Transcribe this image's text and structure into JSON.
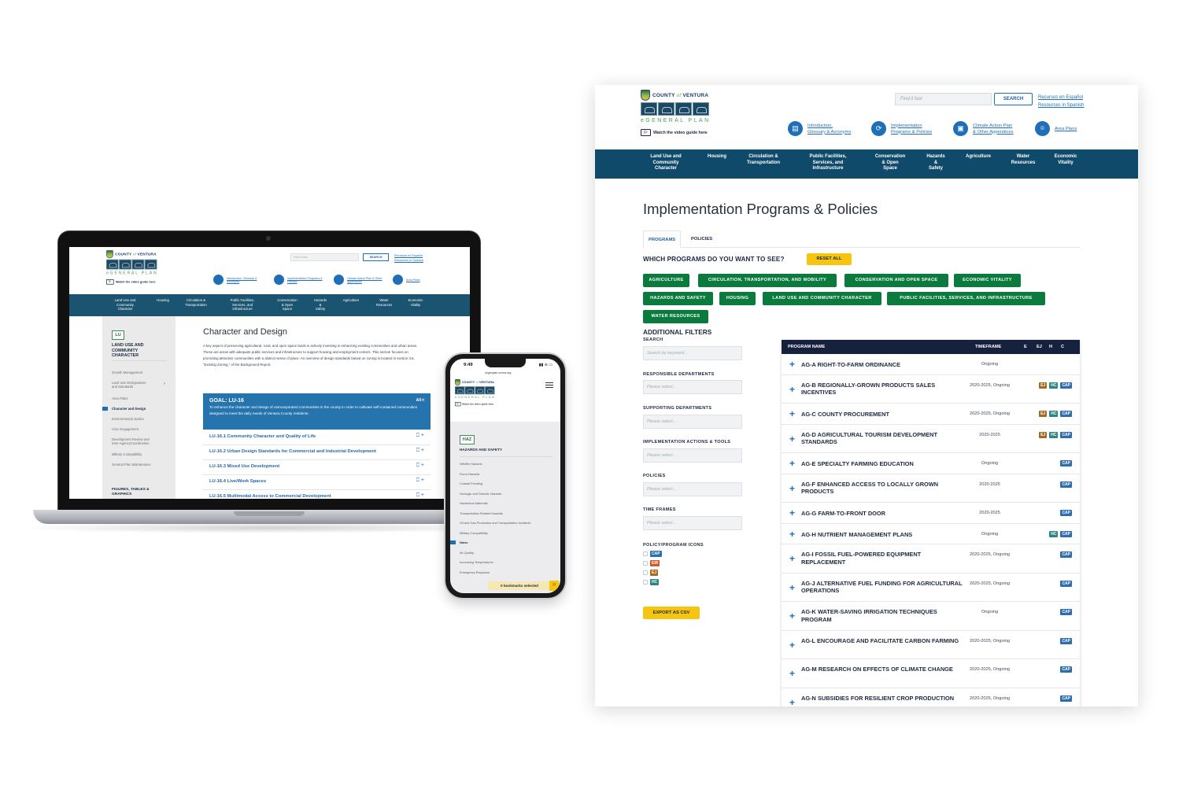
{
  "main_page": {
    "logo": {
      "county": "COUNTY",
      "of": "of",
      "ventura": "VENTURA",
      "plan": "eGENERAL PLAN",
      "video_guide": "Watch the video guide here"
    },
    "search": {
      "placeholder": "Find it fast",
      "button": "SEARCH"
    },
    "language_links": [
      "Recursos en Español",
      "Resources in Spanish"
    ],
    "quick_links": [
      {
        "icon": "book-icon",
        "label_1": "Introduction,",
        "label_2": "Glossary & Acronyms"
      },
      {
        "icon": "programs-icon",
        "label_1": "Implementation",
        "label_2": "Programs & Policies"
      },
      {
        "icon": "climate-icon",
        "label_1": "Climate Action Plan",
        "label_2": "& Other Appendices"
      },
      {
        "icon": "map-pin-icon",
        "label_1": "Area Plans",
        "label_2": ""
      }
    ],
    "nav": [
      "Land Use and\nCommunity\nCharacter",
      "Housing",
      "Circulation &\nTransportation",
      "Public Facilities,\nServices, and\nInfrastructure",
      "Conservation\n& Open\nSpace",
      "Hazards\n&\nSafety",
      "Agriculture",
      "Water\nResources",
      "Economic\nVitality"
    ],
    "title": "Implementation Programs & Policies",
    "tabs": [
      {
        "label": "PROGRAMS",
        "active": true
      },
      {
        "label": "POLICIES",
        "active": false
      }
    ],
    "which_label": "WHICH PROGRAMS DO YOU WANT TO SEE?",
    "reset_label": "RESET ALL",
    "categories": [
      "AGRICULTURE",
      "CIRCULATION, TRANSPORTATION, AND MOBILITY",
      "CONSERVATION AND OPEN SPACE",
      "ECONOMIC VITALITY",
      "HAZARDS AND SAFETY",
      "HOUSING",
      "LAND USE AND COMMUNITY CHARACTER",
      "PUBLIC FACILITIES, SERVICES, AND INFRASTRUCTURE",
      "WATER RESOURCES"
    ],
    "filters": {
      "title": "ADDITIONAL FILTERS",
      "search_label": "SEARCH",
      "search_placeholder": "Search by keyword...",
      "selects": [
        {
          "label": "RESPONSIBLE DEPARTMENTS",
          "placeholder": "Please select..."
        },
        {
          "label": "SUPPORTING DEPARTMENTS",
          "placeholder": "Please select..."
        },
        {
          "label": "IMPLEMENTATION ACTIONS & TOOLS",
          "placeholder": "Please select..."
        },
        {
          "label": "POLICIES",
          "placeholder": "Please select..."
        },
        {
          "label": "TIME FRAMES",
          "placeholder": "Please select..."
        }
      ],
      "icons_label": "POLICY/PROGRAM ICONS",
      "icon_options": [
        "CAP",
        "EIR",
        "EJ",
        "HC"
      ],
      "export_label": "EXPORT AS CSV"
    },
    "table": {
      "headers": {
        "name": "PROGRAM NAME",
        "timeframe": "TIMEFRAME",
        "e": "E",
        "ej": "EJ",
        "h": "H",
        "c": "C"
      },
      "rows": [
        {
          "name": "AG-A RIGHT-TO-FARM ORDINANCE",
          "timeframe": "Ongoing",
          "badges": []
        },
        {
          "name": "AG-B REGIONALLY-GROWN PRODUCTS SALES INCENTIVES",
          "timeframe": "2020-2025, Ongoing",
          "badges": [
            "EJ",
            "HC",
            "CAP"
          ]
        },
        {
          "name": "AG-C COUNTY PROCUREMENT",
          "timeframe": "2020-2025, Ongoing",
          "badges": [
            "EJ",
            "HC",
            "CAP"
          ]
        },
        {
          "name": "AG-D AGRICULTURAL TOURISM DEVELOPMENT STANDARDS",
          "timeframe": "2020-2025",
          "badges": [
            "EJ",
            "HC",
            "CAP"
          ]
        },
        {
          "name": "AG-E SPECIALTY FARMING EDUCATION",
          "timeframe": "Ongoing",
          "badges": [
            "CAP"
          ]
        },
        {
          "name": "AG-F ENHANCED ACCESS TO LOCALLY GROWN PRODUCTS",
          "timeframe": "2020-2025",
          "badges": [
            "CAP"
          ]
        },
        {
          "name": "AG-G FARM-TO-FRONT DOOR",
          "timeframe": "2020-2025",
          "badges": [
            "CAP"
          ]
        },
        {
          "name": "AG-H NUTRIENT MANAGEMENT PLANS",
          "timeframe": "Ongoing",
          "badges": [
            "HC",
            "CAP"
          ]
        },
        {
          "name": "AG-I FOSSIL FUEL-POWERED EQUIPMENT REPLACEMENT",
          "timeframe": "2020-2025, Ongoing",
          "badges": [
            "CAP"
          ]
        },
        {
          "name": "AG-J ALTERNATIVE FUEL FUNDING FOR AGRICULTURAL OPERATIONS",
          "timeframe": "2020-2025, Ongoing",
          "badges": [
            "CAP"
          ]
        },
        {
          "name": "AG-K WATER-SAVING IRRIGATION TECHNIQUES PROGRAM",
          "timeframe": "Ongoing",
          "badges": [
            "CAP"
          ]
        },
        {
          "name": "AG-L ENCOURAGE AND FACILITATE CARBON FARMING",
          "timeframe": "2020-2025, Ongoing",
          "badges": [
            "CAP"
          ]
        },
        {
          "name": "AG-M RESEARCH ON EFFECTS OF CLIMATE CHANGE",
          "timeframe": "2020-2025, Ongoing",
          "badges": [
            "CAP"
          ]
        },
        {
          "name": "AG-N SUBSIDIES FOR RESILIENT CROP PRODUCTION",
          "timeframe": "2020-2025, Ongoing",
          "badges": [
            "CAP"
          ]
        }
      ]
    }
  },
  "laptop_page": {
    "search_placeholder": "Find it fast",
    "search_button": "SEARCH",
    "language_links": [
      "Recursos en Español",
      "Resources in Spanish"
    ],
    "quick_links": [
      "Introduction, Glossary & Acronyms",
      "Implementation Programs & Policies",
      "Climate Action Plan & Other Appendices",
      "Area Plans"
    ],
    "sidebar": {
      "badge": "LU",
      "title": "LAND USE AND\nCOMMUNITY\nCHARACTER",
      "items": [
        {
          "label": "Growth Management",
          "active": false
        },
        {
          "label": "Land Use Designations\nand Standards",
          "active": false,
          "has_arrow": true
        },
        {
          "label": "Area Plans",
          "active": false
        },
        {
          "label": "Character and Design",
          "active": true
        },
        {
          "label": "Environmental Justice",
          "active": false
        },
        {
          "label": "Civic Engagement",
          "active": false
        },
        {
          "label": "Development Review and\nInter-AgencyCoordination",
          "active": false
        },
        {
          "label": "Military Compatibility",
          "active": false
        },
        {
          "label": "General Plan Maintenance",
          "active": false
        }
      ],
      "figures_label": "FIGURES, TABLES &\nGRAPHICS"
    },
    "title": "Character and Design",
    "paragraph": "A key aspect of preserving agricultural, rural, and open space lands is actively investing in enhancing existing communities and urban areas. These are areas with adequate public services and infrastructure to support housing and employment centers. This section focuses on promoting attractive communities with a distinct sense of place. An overview of design standards based on zoning is located in section 3.6, “Existing Zoning,” of the Background Report.",
    "goal": {
      "title": "GOAL: LU-16",
      "all_label": "All",
      "description": "To enhance the character and design of unincorporated communities in the county in order to cultivate self-contained communities designed to meet the daily needs of Ventura County residents."
    },
    "policies": [
      "LU-16.1 Community Character and Quality of Life",
      "LU-16.2 Urban Design Standards for Commercial and Industrial Development",
      "LU-16.3 Mixed Use Development",
      "LU-16.4 Live/Work Spaces",
      "LU-16.5 Multimodal Access to Commercial Development"
    ]
  },
  "phone_page": {
    "time": "9:49",
    "url": "vcgenplan.vcrma.org",
    "section_badge": "HAZ",
    "section_title": "HAZARDS AND SAFETY",
    "items": [
      {
        "label": "Wildfire Hazards",
        "active": false
      },
      {
        "label": "Flood Hazards",
        "active": false
      },
      {
        "label": "Coastal Flooding",
        "active": false
      },
      {
        "label": "Geologic and Seismic Hazards",
        "active": false
      },
      {
        "label": "Hazardous Materials",
        "active": false
      },
      {
        "label": "Transportation Related Hazards",
        "active": false
      },
      {
        "label": "Oil and Gas Production and Transportation Incidents",
        "active": false
      },
      {
        "label": "Military Compatibility",
        "active": false
      },
      {
        "label": "Noise",
        "active": true
      },
      {
        "label": "Air Quality",
        "active": false
      },
      {
        "label": "Increasing Temperatures",
        "active": false
      },
      {
        "label": "Emergency Response",
        "active": false
      }
    ],
    "bookmarks_label": "0 bookmarks selected"
  },
  "colors": {
    "nav_blue": "#0f4a6a",
    "link_blue": "#1e6fb8",
    "chip_green": "#0a7a3d",
    "accent_yellow": "#f7c410",
    "table_header": "#15213d",
    "badge_cap": "#2e6db0",
    "badge_eir": "#cf5a2c",
    "badge_ej": "#a36a22",
    "badge_hc": "#2f8481"
  }
}
